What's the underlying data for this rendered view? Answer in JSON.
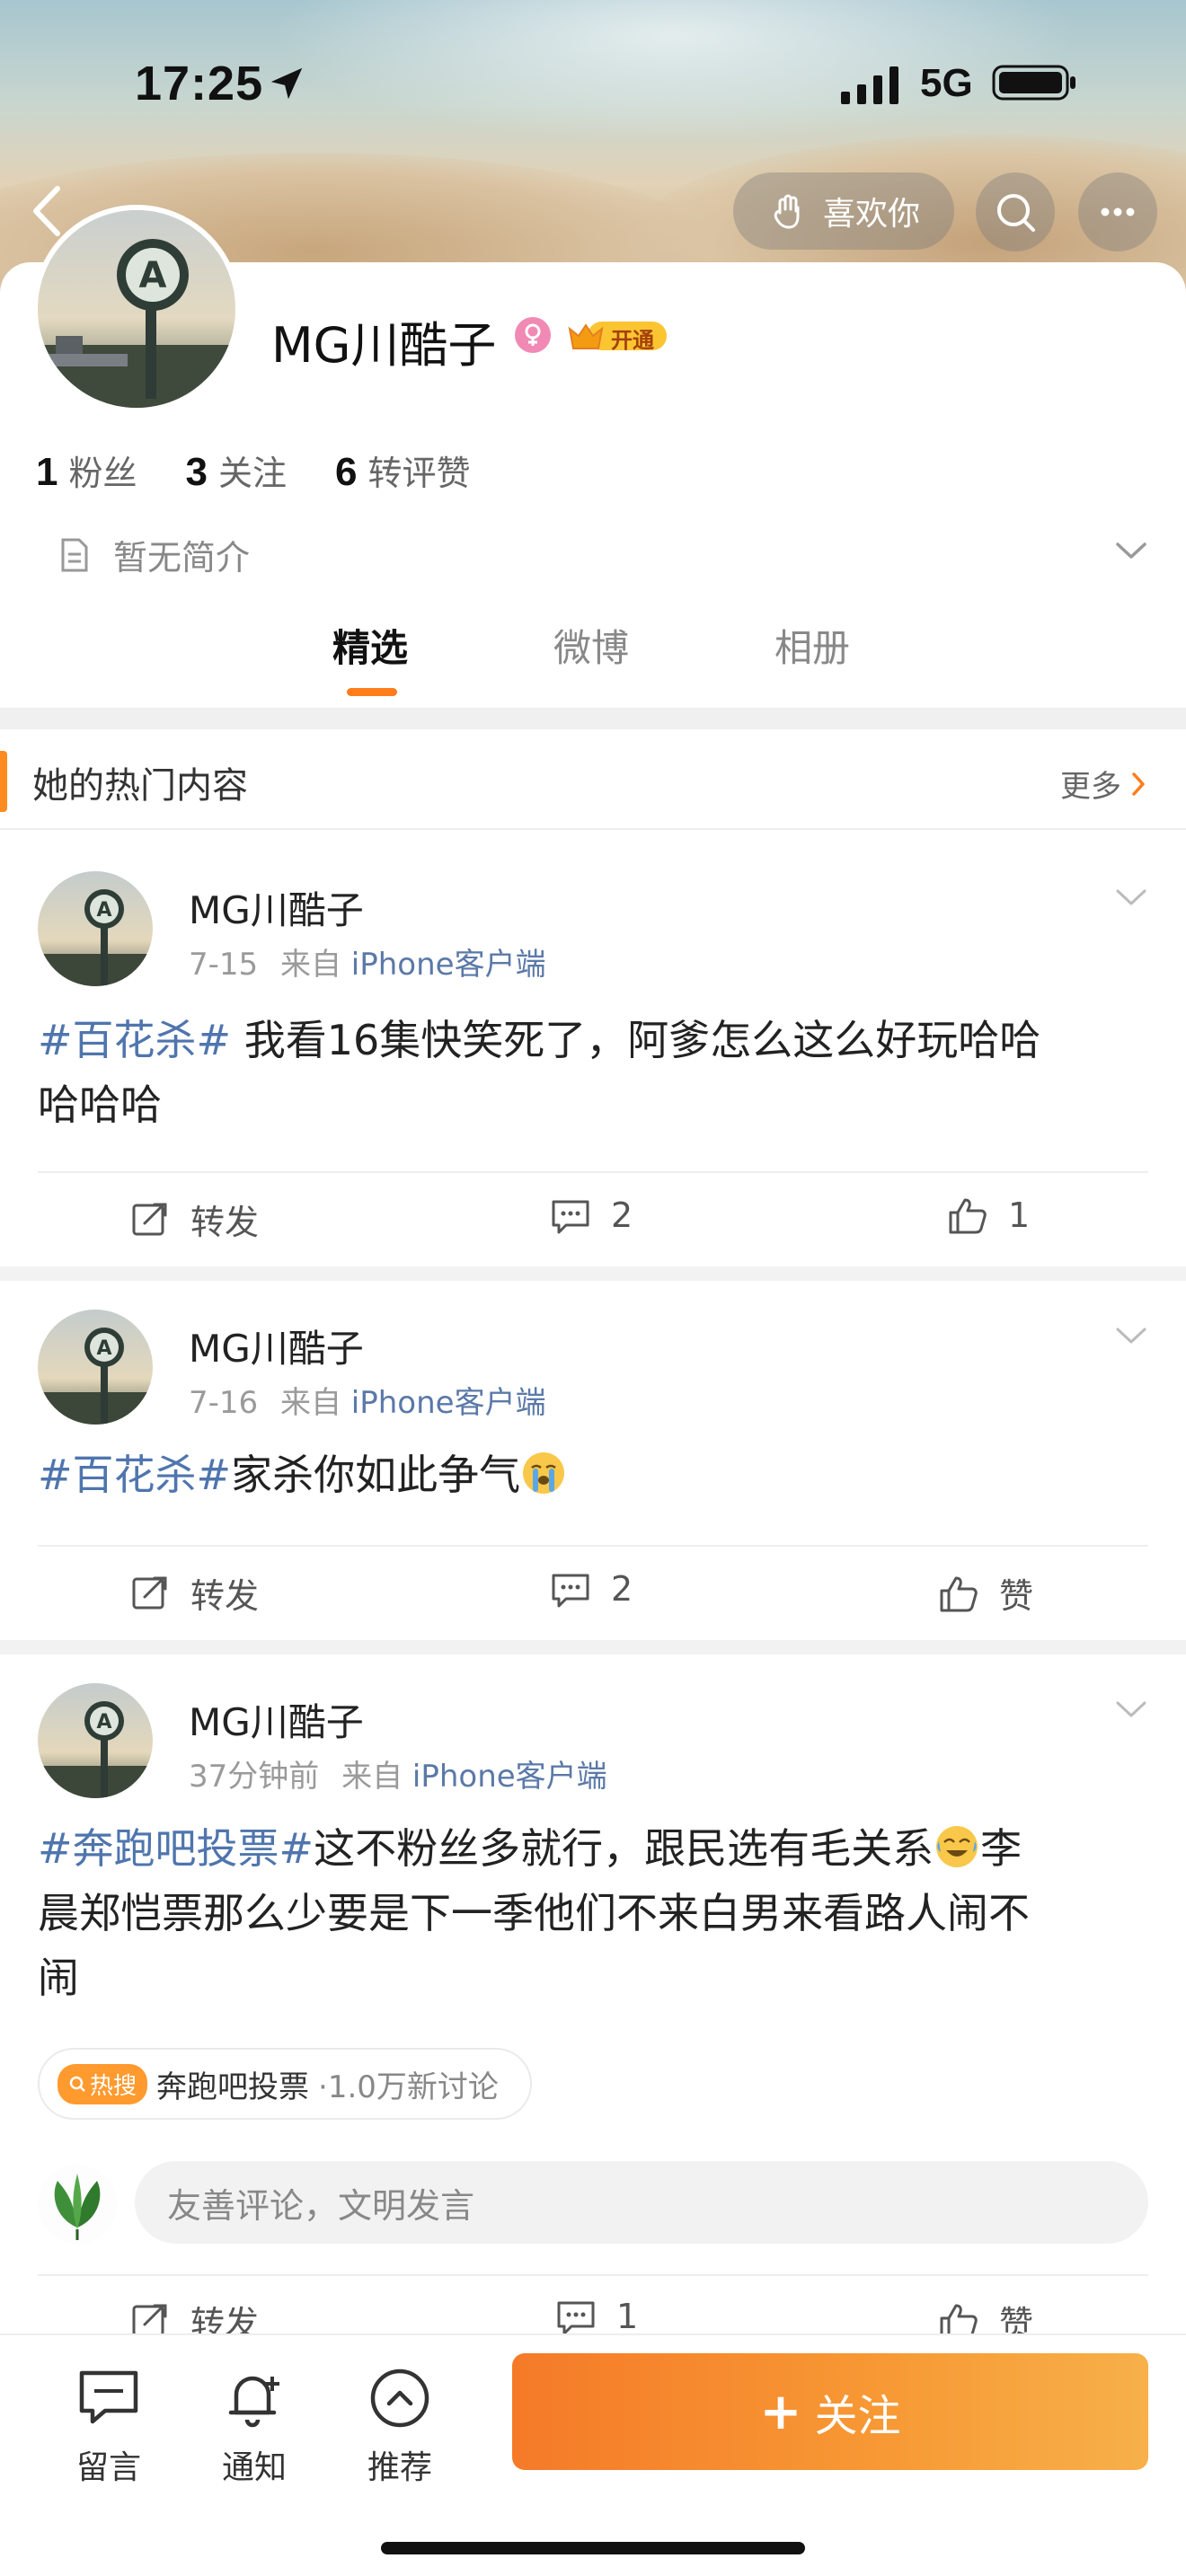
{
  "status_bar": {
    "time": "17:25",
    "network": "5G"
  },
  "header": {
    "like_label": "喜欢你"
  },
  "profile": {
    "name": "MG川酷子",
    "vip_label": "开通",
    "stats": [
      {
        "num": "1",
        "label": "粉丝"
      },
      {
        "num": "3",
        "label": "关注"
      },
      {
        "num": "6",
        "label": "转评赞"
      }
    ],
    "bio": "暂无简介"
  },
  "tabs": [
    {
      "label": "精选",
      "active": true
    },
    {
      "label": "微博",
      "active": false
    },
    {
      "label": "相册",
      "active": false
    }
  ],
  "hot_section": {
    "title": "她的热门内容",
    "more": "更多"
  },
  "posts": [
    {
      "name": "MG川酷子",
      "date": "7-15",
      "from": "来自",
      "source": "iPhone客户端",
      "tag": "#百花杀#",
      "text_line1": " 我看16集快笑死了，阿爹怎么这么好玩哈哈",
      "text_line2": "哈哈哈",
      "repost": "转发",
      "comments": "2",
      "likes": "1"
    },
    {
      "name": "MG川酷子",
      "date": "7-16",
      "from": "来自",
      "source": "iPhone客户端",
      "tag": "#百花杀#",
      "text_line1": "家杀你如此争气",
      "emoji": "crying-face",
      "repost": "转发",
      "comments": "2",
      "likes": "赞"
    },
    {
      "name": "MG川酷子",
      "date": "37分钟前",
      "from": "来自",
      "source": "iPhone客户端",
      "tag": "#奔跑吧投票#",
      "text_line1": "这不粉丝多就行，跟民选有毛关系",
      "text_line1_after": "李",
      "text_line2": "晨郑恺票那么少要是下一季他们不来白男来看路人闹不",
      "text_line3": "闹",
      "emoji": "laugh-cry-face",
      "hot_chip": {
        "pill": "热搜",
        "topic": "奔跑吧投票",
        "count": "·1.0万新讨论"
      },
      "comment_placeholder": "友善评论，文明发言",
      "repost": "转发",
      "comments": "1",
      "likes": "赞"
    }
  ],
  "bottom_nav": {
    "items": [
      {
        "label": "留言",
        "icon": "message-icon"
      },
      {
        "label": "通知",
        "icon": "bell-icon"
      },
      {
        "label": "推荐",
        "icon": "arrow-up-circle-icon"
      }
    ],
    "follow_label": "关注",
    "follow_plus": "+"
  },
  "colors": {
    "accent": "#ff7d1a",
    "link": "#4f75ad",
    "follow_start": "#f57a28",
    "follow_end": "#f7b04a"
  }
}
